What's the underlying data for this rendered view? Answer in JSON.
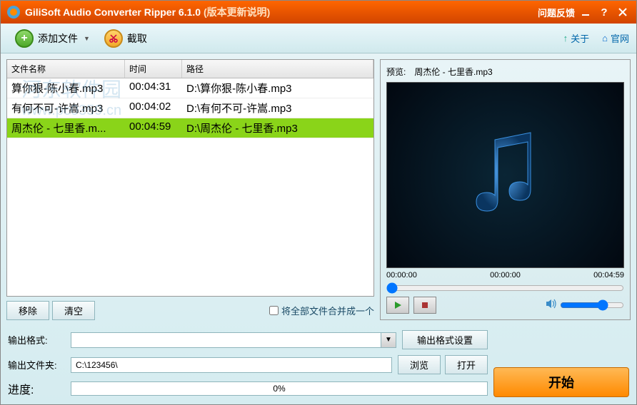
{
  "titlebar": {
    "app_name": "GiliSoft Audio Converter Ripper 6.1.0",
    "version_note": "(版本更新说明)",
    "feedback": "问题反馈"
  },
  "toolbar": {
    "add_file": "添加文件",
    "trim": "截取",
    "about": "关于",
    "website": "官网"
  },
  "columns": {
    "name": "文件名称",
    "time": "时间",
    "path": "路径"
  },
  "files": [
    {
      "name": "算你狠-陈小春.mp3",
      "time": "00:04:31",
      "path": "D:\\算你狠-陈小春.mp3",
      "selected": false
    },
    {
      "name": "有何不可-许嵩.mp3",
      "time": "00:04:02",
      "path": "D:\\有何不可-许嵩.mp3",
      "selected": false
    },
    {
      "name": "周杰伦 - 七里香.m...",
      "time": "00:04:59",
      "path": "D:\\周杰伦 - 七里香.mp3",
      "selected": true
    }
  ],
  "file_buttons": {
    "remove": "移除",
    "clear": "清空",
    "merge_label": "将全部文件合并成一个"
  },
  "preview": {
    "label": "预览:",
    "filename": "周杰伦 - 七里香.mp3",
    "time_current": "00:00:00",
    "time_mid": "00:00:00",
    "time_total": "00:04:59"
  },
  "output": {
    "format_label": "输出格式:",
    "format_value": "",
    "format_settings": "输出格式设置",
    "folder_label": "输出文件夹:",
    "folder_value": "C:\\123456\\",
    "browse": "浏览",
    "open": "打开",
    "progress_label": "进度:",
    "progress_value": "0%",
    "start": "开始"
  },
  "watermark": {
    "text1": "河东软件园",
    "text2": "www.pc0359.cn"
  }
}
